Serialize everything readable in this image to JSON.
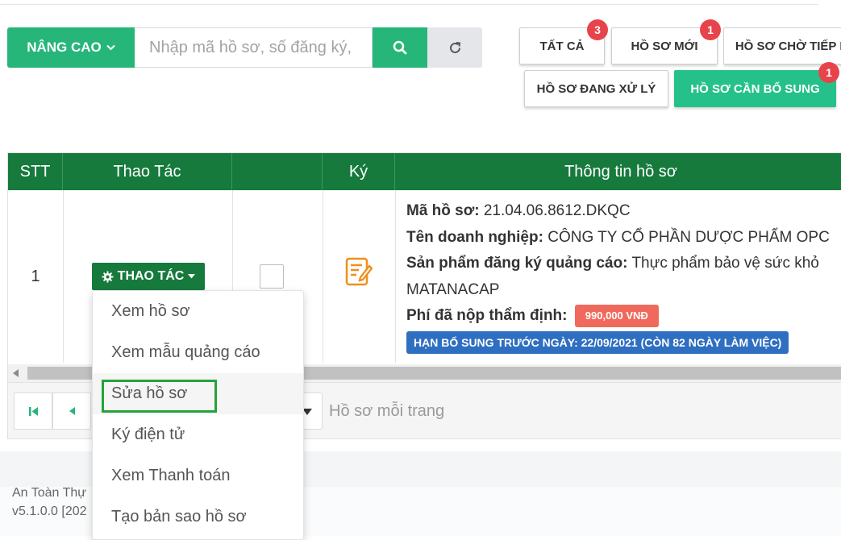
{
  "search": {
    "advanced_label": "NÂNG CAO",
    "placeholder": "Nhập mã hồ sơ, số đăng ký,"
  },
  "icons": {
    "advanced_chevron": "chevron-down-icon",
    "search": "search-icon",
    "refresh": "refresh-icon",
    "gear": "gear-icon",
    "sign": "pencil-document-icon",
    "first_page": "first-page-icon",
    "prev_page": "prev-page-icon",
    "select_caret": "caret-down-icon"
  },
  "filters": [
    {
      "label": "TẤT CẢ",
      "count": "3"
    },
    {
      "label": "HỒ SƠ MỚI",
      "count": "1"
    },
    {
      "label": "HỒ SƠ CHỜ TIẾP N"
    },
    {
      "label": "HỒ SƠ ĐANG XỬ LÝ"
    },
    {
      "label": "HỒ SƠ CẦN BỔ SUNG",
      "count": "1"
    }
  ],
  "table": {
    "headers": [
      "STT",
      "Thao Tác",
      "",
      "Ký",
      "Thông tin hồ sơ"
    ],
    "rows": [
      {
        "stt": "1",
        "action_label": "THAO TÁC",
        "ma_label": "Mã hồ sơ:",
        "ma_value": "21.04.06.8612.DKQC",
        "dn_label": "Tên doanh nghiệp:",
        "dn_value": "CÔNG TY CỔ PHẦN DƯỢC PHẨM OPC",
        "sp_label": "Sản phẩm đăng ký quảng cáo:",
        "sp_value": "Thực phẩm bảo vệ sức khỏ",
        "sp_value2": "MATANACAP",
        "fee_label": "Phí đã nộp thẩm định:",
        "fee_value": "990,000 VNĐ",
        "deadline": "HẠN BỔ SUNG TRƯỚC NGÀY: 22/09/2021 (CÒN 82 NGÀY LÀM VIỆC)"
      }
    ]
  },
  "pager": {
    "per_page_label": "Hồ sơ mỗi trang"
  },
  "footer": {
    "line1": "An Toàn Thự",
    "line2": "v5.1.0.0 [202"
  },
  "dropdown": {
    "items": [
      "Xem hồ sơ",
      "Xem mẫu quảng cáo",
      "Sửa hồ sơ",
      "Ký điện tử",
      "Xem Thanh toán",
      "Tạo bản sao hồ sơ"
    ]
  },
  "colors": {
    "primary_green": "#26b67a",
    "header_green": "#167a3d",
    "badge_red": "#e8434b",
    "fee_red": "#ef6a5c",
    "deadline_blue": "#2f6fc1",
    "highlight_green": "#25a33a"
  }
}
